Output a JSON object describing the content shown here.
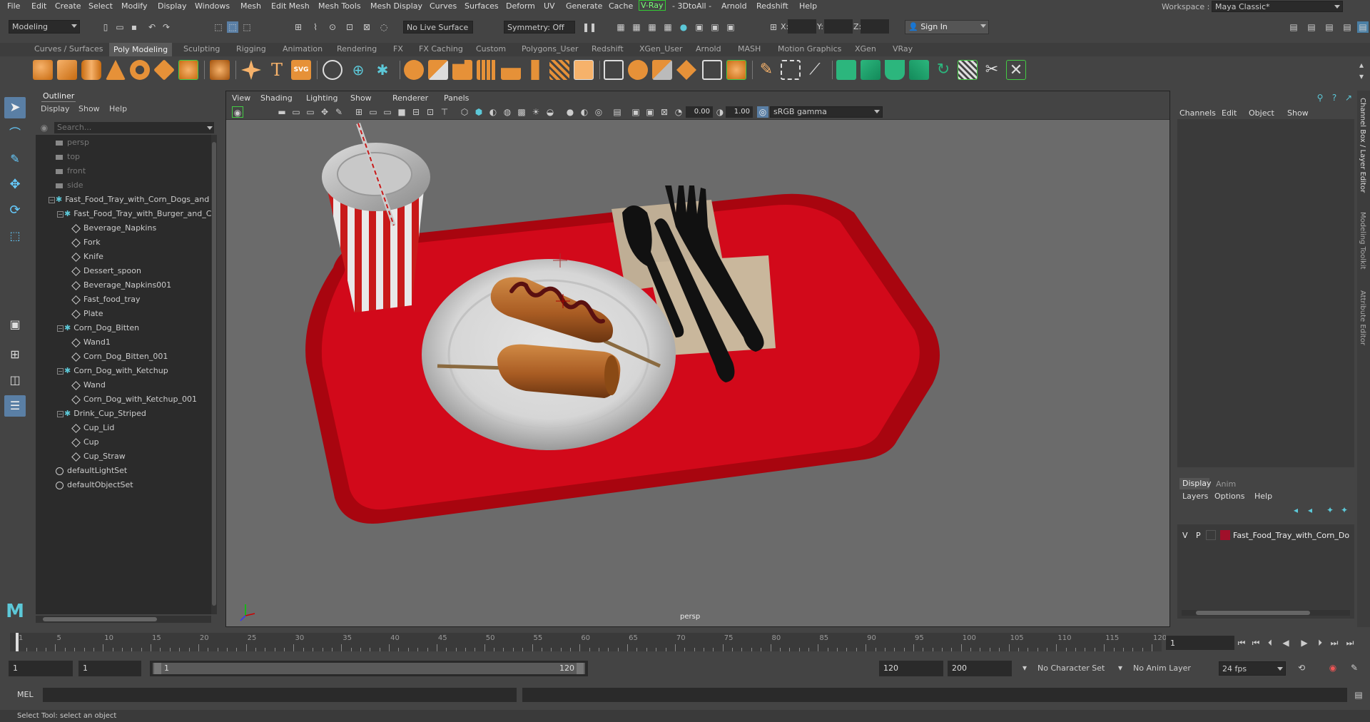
{
  "menubar": {
    "items": [
      "File",
      "Edit",
      "Create",
      "Select",
      "Modify",
      "Display",
      "Windows",
      "Mesh",
      "Edit Mesh",
      "Mesh Tools",
      "Mesh Display",
      "Curves",
      "Surfaces",
      "Deform",
      "UV",
      "Generate",
      "Cache",
      "V-Ray",
      "- 3DtoAll -",
      "Arnold",
      "Redshift",
      "Help"
    ],
    "workspace_label": "Workspace :",
    "workspace_value": "Maya Classic*"
  },
  "statusline": {
    "mode": "Modeling",
    "live_surface": "No Live Surface",
    "symmetry": "Symmetry: Off",
    "x_label": "X:",
    "y_label": "Y:",
    "z_label": "Z:",
    "sign_in": "Sign In"
  },
  "shelf": {
    "tabs": [
      "Curves / Surfaces",
      "Poly Modeling",
      "Sculpting",
      "Rigging",
      "Animation",
      "Rendering",
      "FX",
      "FX Caching",
      "Custom",
      "Polygons_User",
      "Redshift",
      "XGen_User",
      "Arnold",
      "MASH",
      "Motion Graphics",
      "XGen",
      "VRay"
    ],
    "active_tab": "Poly Modeling"
  },
  "outliner": {
    "title": "Outliner",
    "menu": [
      "Display",
      "Show",
      "Help"
    ],
    "search_placeholder": "Search...",
    "items": [
      {
        "label": "persp",
        "type": "camera",
        "indent": 0,
        "dim": true
      },
      {
        "label": "top",
        "type": "camera",
        "indent": 0,
        "dim": true
      },
      {
        "label": "front",
        "type": "camera",
        "indent": 0,
        "dim": true
      },
      {
        "label": "side",
        "type": "camera",
        "indent": 0,
        "dim": true
      },
      {
        "label": "Fast_Food_Tray_with_Corn_Dogs_and",
        "type": "group",
        "indent": 0,
        "expand": true
      },
      {
        "label": "Fast_Food_Tray_with_Burger_and_C",
        "type": "group",
        "indent": 1,
        "expand": true
      },
      {
        "label": "Beverage_Napkins",
        "type": "mesh",
        "indent": 2
      },
      {
        "label": "Fork",
        "type": "mesh",
        "indent": 2
      },
      {
        "label": "Knife",
        "type": "mesh",
        "indent": 2
      },
      {
        "label": "Dessert_spoon",
        "type": "mesh",
        "indent": 2
      },
      {
        "label": "Beverage_Napkins001",
        "type": "mesh",
        "indent": 2
      },
      {
        "label": "Fast_food_tray",
        "type": "mesh",
        "indent": 2
      },
      {
        "label": "Plate",
        "type": "mesh",
        "indent": 2
      },
      {
        "label": "Corn_Dog_Bitten",
        "type": "group",
        "indent": 1,
        "expand": true
      },
      {
        "label": "Wand1",
        "type": "mesh",
        "indent": 2
      },
      {
        "label": "Corn_Dog_Bitten_001",
        "type": "mesh",
        "indent": 2
      },
      {
        "label": "Corn_Dog_with_Ketchup",
        "type": "group",
        "indent": 1,
        "expand": true
      },
      {
        "label": "Wand",
        "type": "mesh",
        "indent": 2
      },
      {
        "label": "Corn_Dog_with_Ketchup_001",
        "type": "mesh",
        "indent": 2
      },
      {
        "label": "Drink_Cup_Striped",
        "type": "group",
        "indent": 1,
        "expand": true
      },
      {
        "label": "Cup_Lid",
        "type": "mesh",
        "indent": 2
      },
      {
        "label": "Cup",
        "type": "mesh",
        "indent": 2
      },
      {
        "label": "Cup_Straw",
        "type": "mesh",
        "indent": 2
      },
      {
        "label": "defaultLightSet",
        "type": "set",
        "indent": 0
      },
      {
        "label": "defaultObjectSet",
        "type": "set",
        "indent": 0
      }
    ]
  },
  "viewport": {
    "menu": [
      "View",
      "Shading",
      "Lighting",
      "Show",
      "Renderer",
      "Panels"
    ],
    "exposure": "0.00",
    "gamma": "1.00",
    "color_space": "sRGB gamma",
    "camera_label": "persp"
  },
  "channelbox": {
    "menu": [
      "Channels",
      "Edit",
      "Object",
      "Show"
    ],
    "tabs": [
      "Display",
      "Anim"
    ],
    "layer_menu": [
      "Layers",
      "Options",
      "Help"
    ],
    "layer": {
      "v": "V",
      "p": "P",
      "name": "Fast_Food_Tray_with_Corn_Do",
      "color": "#a0102a"
    }
  },
  "side_tabs": [
    "Channel Box / Layer Editor",
    "Modeling Toolkit",
    "Attribute Editor"
  ],
  "timeline": {
    "ticks": [
      "1",
      "5",
      "10",
      "15",
      "20",
      "25",
      "30",
      "35",
      "40",
      "45",
      "50",
      "55",
      "60",
      "65",
      "70",
      "75",
      "80",
      "85",
      "90",
      "95",
      "100",
      "105",
      "110",
      "115",
      "120"
    ],
    "current_frame": "1"
  },
  "range": {
    "start": "1",
    "playback_start": "1",
    "slider_start": "1",
    "slider_end": "120",
    "playback_end": "120",
    "end": "200",
    "character_set": "No Character Set",
    "anim_layer": "No Anim Layer",
    "fps": "24 fps"
  },
  "cmdline": {
    "label": "MEL"
  },
  "helpline": {
    "text": "Select Tool: select an object"
  },
  "colors": {
    "tray": "#d2091a",
    "accent": "#5cc8d8",
    "bg": "#444444"
  }
}
